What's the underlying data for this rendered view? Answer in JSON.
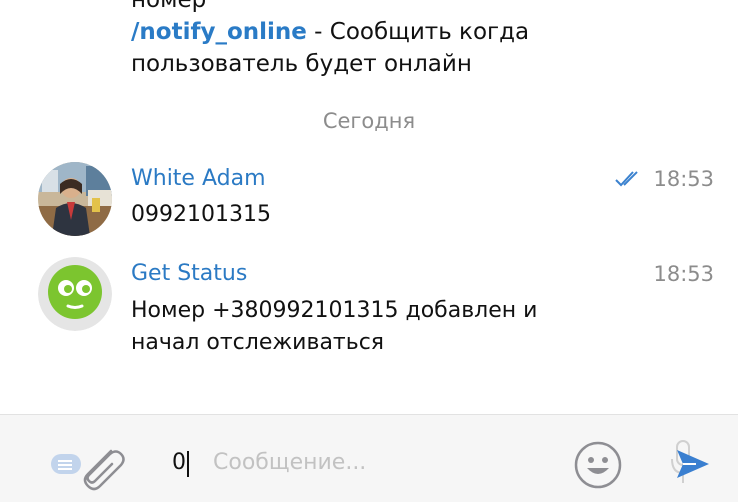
{
  "previous_message": {
    "line_prefix": "номер",
    "command": "/notify_online",
    "command_desc": " - Сообщить когда",
    "line_2": "пользователь будет онлайн"
  },
  "date_separator": "Сегодня",
  "messages": [
    {
      "sender": "White Adam",
      "time": "18:53",
      "text": "0992101315",
      "status": "double-check-read",
      "avatar": "user-photo-avatar"
    },
    {
      "sender": "Get Status",
      "time": "18:53",
      "text": "Номер +380992101315 добавлен и начал отслеживаться",
      "avatar": "bot-avatar-green"
    }
  ],
  "composer": {
    "value": "0",
    "placeholder": "Сообщение..."
  },
  "colors": {
    "link": "#2b7ac4",
    "time": "#8c8c8c",
    "send": "#3a7fd0",
    "bot_green": "#7cc52f"
  },
  "icons": [
    "paperclip-icon",
    "emoji-icon",
    "mic-icon",
    "send-icon",
    "double-check-icon"
  ]
}
